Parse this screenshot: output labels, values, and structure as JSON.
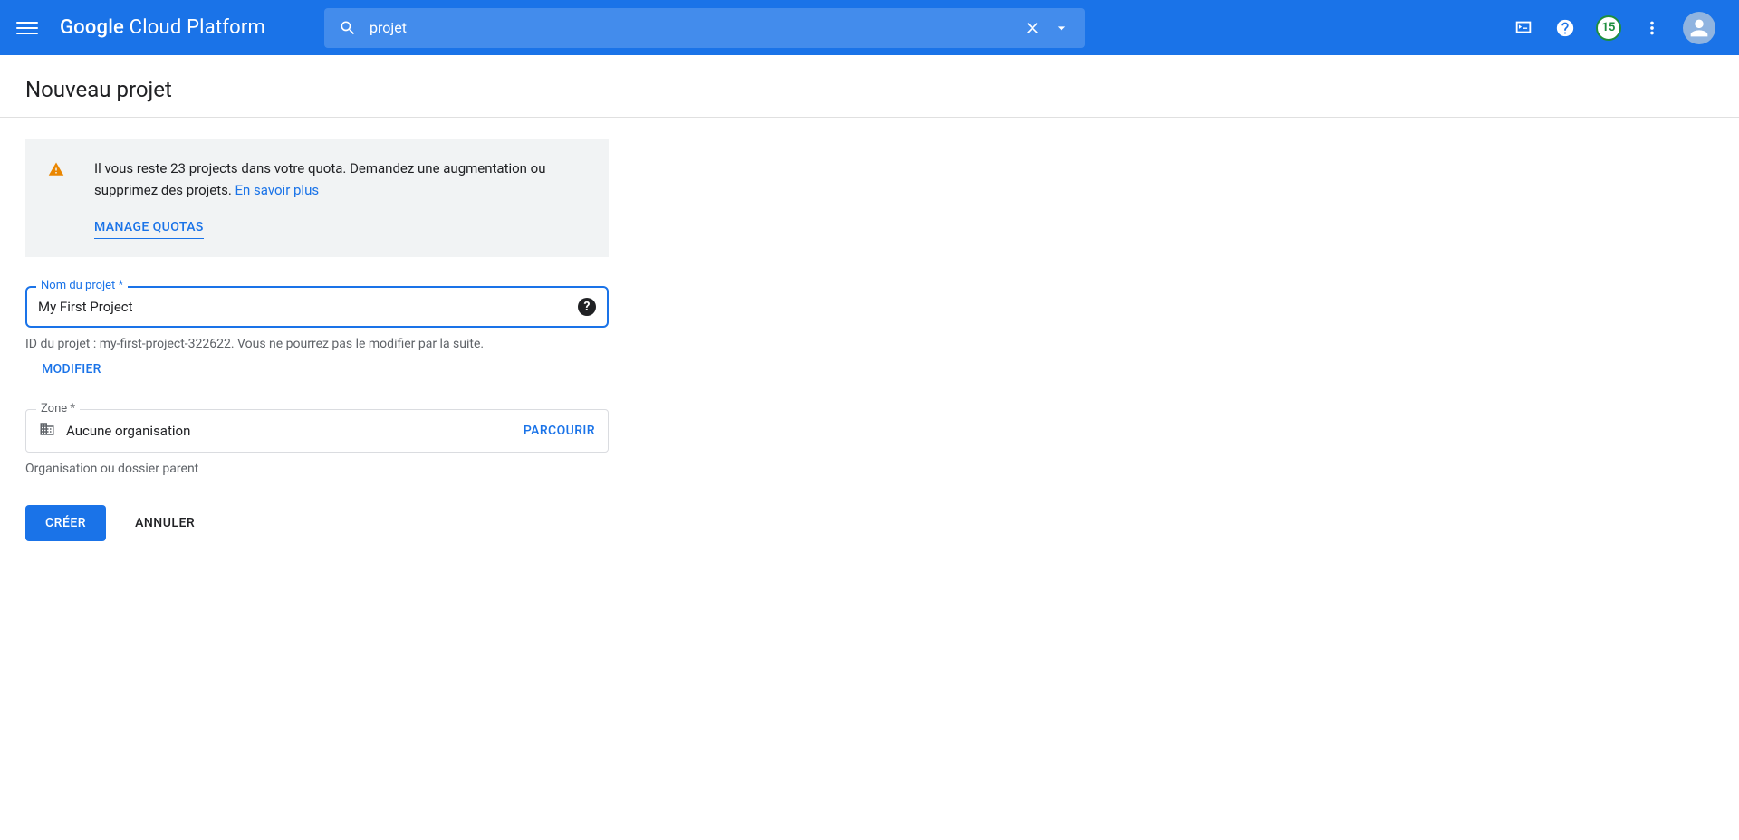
{
  "header": {
    "brand_prefix": "Google",
    "brand_rest": " Cloud Platform",
    "search_value": "projet",
    "trial_badge": "15"
  },
  "page": {
    "title": "Nouveau projet"
  },
  "notice": {
    "text": "Il vous reste 23 projects dans votre quota. Demandez une augmentation ou supprimez des projets. ",
    "learn_more": "En savoir plus",
    "manage_quotas": "MANAGE QUOTAS"
  },
  "project_name": {
    "label": "Nom du projet *",
    "value": "My First Project",
    "hint_prefix": "ID du projet : ",
    "project_id": "my-first-project-322622",
    "hint_suffix": ". Vous ne pourrez pas le modifier par la suite.",
    "modify_label": "MODIFIER"
  },
  "zone": {
    "label": "Zone *",
    "value": "Aucune organisation",
    "browse_label": "PARCOURIR",
    "hint": "Organisation ou dossier parent"
  },
  "actions": {
    "create": "CRÉER",
    "cancel": "ANNULER"
  }
}
